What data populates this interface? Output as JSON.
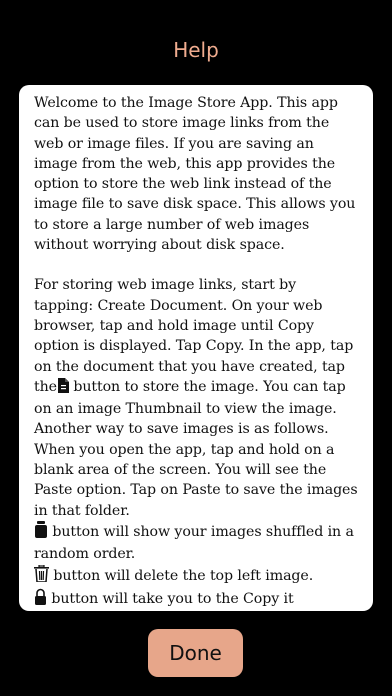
{
  "header": {
    "title": "Help"
  },
  "help": {
    "paragraph1": "Welcome to the Image Store App. This app can be used to store image links from the web or image files. If you are saving an image from the web, this app provides the option to store the web link instead of the image file to save disk space. This allows you to store a large number of web images without worrying about disk space.",
    "paragraph2_a": "For storing web image links, start by tapping: Create Document. On your web browser, tap and hold image until Copy option is displayed. Tap Copy. In the app,  tap on the document that you have created, tap the",
    "paragraph2_b": " button to store the image. You can tap on an image Thumbnail to view the image.",
    "paragraph3": "Another way to save images is as follows. When you open the app, tap and hold on a blank area of the screen. You will see the Paste option. Tap on Paste to save the images in that folder.",
    "paragraph4": " button will show your images shuffled in a random order.",
    "paragraph5": " button will delete the top left image.",
    "paragraph6": " button will take you to the Copy it"
  },
  "icons": {
    "paste": "doc-paste-icon",
    "shuffle": "shuffle-jar-icon",
    "trash": "trash-icon",
    "lock": "lock-icon"
  },
  "footer": {
    "done_label": "Done"
  }
}
